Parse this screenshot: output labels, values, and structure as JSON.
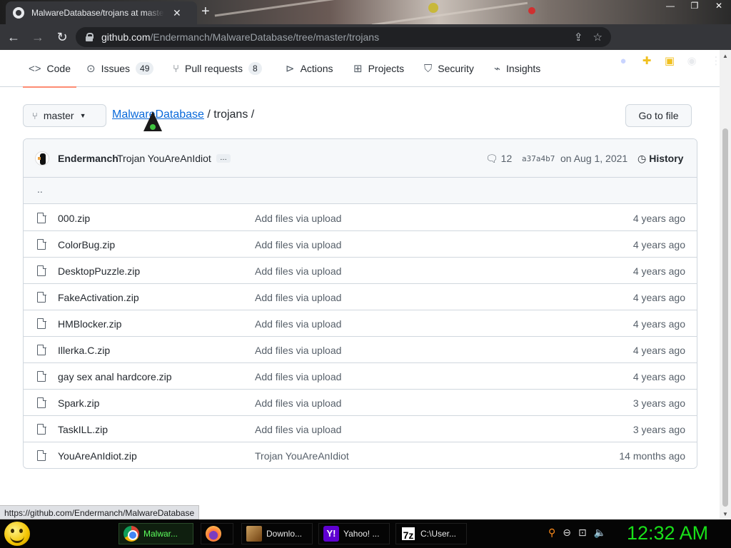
{
  "browser": {
    "tab_title": "MalwareDatabase/trojans at master",
    "tab_close": "✕",
    "new_tab": "+",
    "window_controls": [
      "—",
      "❐",
      "✕"
    ],
    "url_host": "github.com",
    "url_path": "/Endermanch/MalwareDatabase/tree/master/trojans"
  },
  "repo_nav": {
    "items": [
      {
        "label": "Code",
        "icon": "code-icon"
      },
      {
        "label": "Issues",
        "icon": "issue-icon",
        "count": "49"
      },
      {
        "label": "Pull requests",
        "icon": "pull-request-icon",
        "count": "8"
      },
      {
        "label": "Actions",
        "icon": "play-icon"
      },
      {
        "label": "Projects",
        "icon": "table-icon"
      },
      {
        "label": "Security",
        "icon": "shield-icon"
      },
      {
        "label": "Insights",
        "icon": "graph-icon"
      }
    ]
  },
  "branch": {
    "label": "master"
  },
  "breadcrumb": {
    "repo": "MalwareDatabase",
    "sep1": " / ",
    "folder": "trojans",
    "sep2": " /"
  },
  "goto_file": "Go to file",
  "commit": {
    "author": "Endermanch",
    "message": "Trojan YouAreAnIdiot",
    "ellipsis": "…",
    "comments": "12",
    "sha": "a37a4b7",
    "date": "on Aug 1, 2021",
    "history": "History"
  },
  "parent_dir": "..",
  "files": [
    {
      "name": "000.zip",
      "message": "Add files via upload",
      "age": "4 years ago"
    },
    {
      "name": "ColorBug.zip",
      "message": "Add files via upload",
      "age": "4 years ago"
    },
    {
      "name": "DesktopPuzzle.zip",
      "message": "Add files via upload",
      "age": "4 years ago"
    },
    {
      "name": "FakeActivation.zip",
      "message": "Add files via upload",
      "age": "4 years ago"
    },
    {
      "name": "HMBlocker.zip",
      "message": "Add files via upload",
      "age": "4 years ago"
    },
    {
      "name": "Illerka.C.zip",
      "message": "Add files via upload",
      "age": "4 years ago"
    },
    {
      "name": "gay sex anal hardcore.zip",
      "message": "Add files via upload",
      "age": "4 years ago"
    },
    {
      "name": "Spark.zip",
      "message": "Add files via upload",
      "age": "3 years ago"
    },
    {
      "name": "TaskILL.zip",
      "message": "Add files via upload",
      "age": "3 years ago"
    },
    {
      "name": "YouAreAnIdiot.zip",
      "message": "Trojan YouAreAnIdiot",
      "age": "14 months ago"
    }
  ],
  "status_url": "https://github.com/Endermanch/MalwareDatabase",
  "taskbar": {
    "tasks": [
      {
        "label": "Malwar...",
        "icon": "chrome-icon"
      },
      {
        "label": "",
        "icon": "firefox-icon"
      },
      {
        "label": "Downlo...",
        "icon": "downloads-icon"
      },
      {
        "label": "Yahoo! ...",
        "icon": "yahoo-icon"
      },
      {
        "label": "C:\\User...",
        "icon": "7zip-icon"
      }
    ],
    "clock": "12:32 AM"
  },
  "colors": {
    "accent_underline": "#fd8c73",
    "link": "#0969da",
    "clock": "#19e019"
  }
}
